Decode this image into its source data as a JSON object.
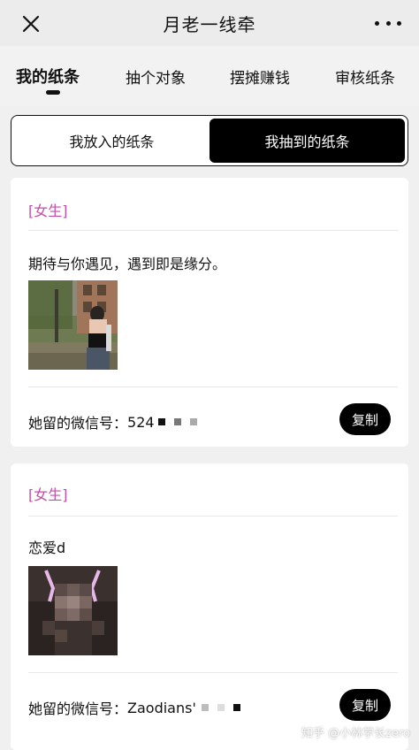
{
  "nav": {
    "title": "月老一线牵",
    "close_icon": "close-icon",
    "more_icon": "more-dots-icon"
  },
  "tabs": [
    {
      "label": "我的纸条",
      "active": true
    },
    {
      "label": "抽个对象",
      "active": false
    },
    {
      "label": "摆摊赚钱",
      "active": false
    },
    {
      "label": "审核纸条",
      "active": false
    }
  ],
  "segmented": {
    "left_label": "我放入的纸条",
    "right_label": "我抽到的纸条",
    "selected": "right"
  },
  "cards": [
    {
      "tag": "[女生]",
      "message": "期待与你遇见，遇到即是缘分。",
      "wechat_label": "她留的微信号：",
      "wechat_value": "524",
      "copy_label": "复制"
    },
    {
      "tag": "[女生]",
      "message": "恋爱d",
      "wechat_label": "她留的微信号：",
      "wechat_value": "Zaodians'",
      "copy_label": "复制"
    }
  ],
  "watermark": "知乎 @小林学长zero",
  "colors": {
    "tag": "#c24ca9",
    "accent": "#000000",
    "background": "#f0f0f0"
  }
}
